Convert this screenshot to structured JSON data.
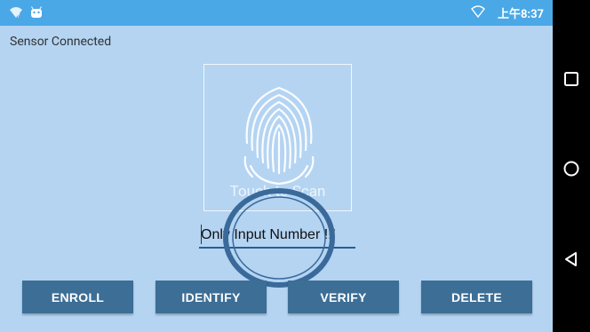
{
  "status_bar": {
    "time": "上午8:37",
    "icons": [
      "wifi-call-icon",
      "android-icon",
      "wifi-icon"
    ]
  },
  "sensor_status": "Sensor Connected",
  "fingerprint": {
    "touch_hint": "Touch to Scan"
  },
  "number_input": {
    "placeholder": "Only Input Number !!!",
    "value": ""
  },
  "buttons": {
    "enroll": "ENROLL",
    "identify": "IDENTIFY",
    "verify": "VERIFY",
    "delete": "DELETE"
  },
  "nav": [
    "recents-icon",
    "home-icon",
    "back-icon"
  ],
  "colors": {
    "background": "#b4d4f2",
    "status_bar": "#4aa8e6",
    "button": "#3c6e96"
  }
}
